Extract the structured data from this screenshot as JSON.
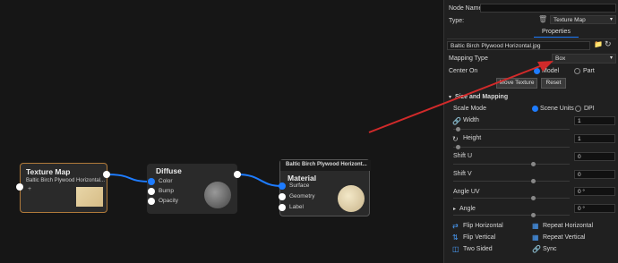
{
  "nodes": {
    "texture_map": {
      "title": "Texture Map",
      "subtitle": "Baltic Birch Plywood Horizontal...",
      "plus": "+"
    },
    "diffuse": {
      "title": "Diffuse",
      "inputs": [
        "Color",
        "Bump",
        "Opacity"
      ]
    },
    "material": {
      "header": "Baltic Birch Plywood Horizont...",
      "title": "Material",
      "inputs": [
        "Surface",
        "Geometry",
        "Label"
      ]
    }
  },
  "panel": {
    "node_name_label": "Node Name:",
    "node_name_value": "",
    "type_label": "Type:",
    "type_value": "Texture Map",
    "tab_properties": "Properties",
    "file_name": "Baltic Birch Plywood Horizontal.jpg",
    "mapping_type_label": "Mapping Type",
    "mapping_type_value": "Box",
    "center_on_label": "Center On",
    "center_model": "Model",
    "center_part": "Part",
    "move_texture": "Move Texture",
    "reset": "Reset",
    "section_size_mapping": "Size and Mapping",
    "scale_mode_label": "Scale Mode",
    "scale_scene_units": "Scene Units",
    "scale_dpi": "DPI",
    "width_label": "Width",
    "width_value": "1",
    "height_label": "Height",
    "height_value": "1",
    "shift_u_label": "Shift U",
    "shift_u_value": "0",
    "shift_v_label": "Shift V",
    "shift_v_value": "0",
    "angle_uv_label": "Angle UV",
    "angle_uv_value": "0 °",
    "angle_label": "Angle",
    "angle_value": "0 °",
    "flip_horizontal": "Flip Horizontal",
    "repeat_horizontal": "Repeat Horizontal",
    "flip_vertical": "Flip Vertical",
    "repeat_vertical": "Repeat Vertical",
    "two_sided": "Two Sided",
    "sync": "Sync"
  },
  "colors": {
    "accent": "#1e7cff",
    "arrow": "#d12a2a"
  }
}
